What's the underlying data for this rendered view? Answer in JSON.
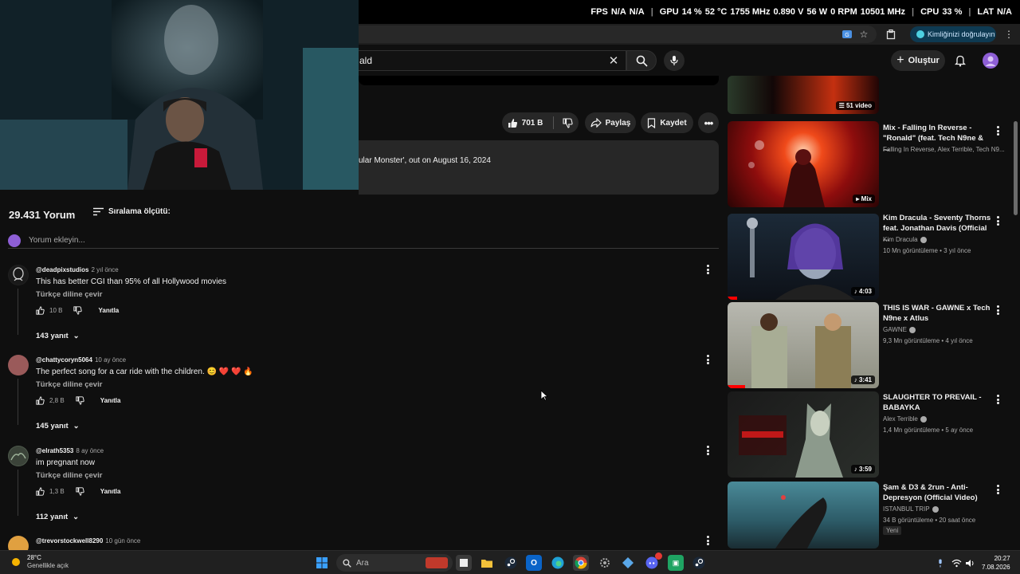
{
  "osd": {
    "fps_label": "FPS",
    "fps_value1": "N/A",
    "fps_value2": "N/A",
    "gpu_label": "GPU",
    "gpu_load": "14 %",
    "gpu_temp": "52 °C",
    "gpu_clock": "1755 MHz",
    "gpu_volt": "0.890 V",
    "gpu_power": "56 W",
    "gpu_fan": "0 RPM",
    "gpu_mem": "10501 MHz",
    "cpu_label": "CPU",
    "cpu_load": "33 %",
    "lat_label": "LAT",
    "lat_value": "N/A"
  },
  "browser": {
    "identity_button": "Kimliğinizi doğrulayın"
  },
  "header": {
    "search_value": "ald",
    "create_label": "Oluştur"
  },
  "actions": {
    "like_count": "701 B",
    "share_label": "Paylaş",
    "save_label": "Kaydet"
  },
  "description": {
    "text": "ular Monster', out on August 16, 2024"
  },
  "comments_section": {
    "count": "29.431 Yorum",
    "sort_label": "Sıralama ölçütü:",
    "add_placeholder": "Yorum ekleyin...",
    "comments": [
      {
        "author": "@deadpixstudios",
        "time": "2 yıl önce",
        "text": "This has better CGI than 95% of all Hollywood movies",
        "translate": "Türkçe diline çevir",
        "likes": "10 B",
        "reply": "Yanıtla",
        "replies": "143 yanıt",
        "avatar_color": "#d8d8d8"
      },
      {
        "author": "@chattycoryn5064",
        "time": "10 ay önce",
        "text": "The perfect song for a car ride with the children. 😊 ❤️ ❤️ 🔥",
        "translate": "Türkçe diline çevir",
        "likes": "2,8 B",
        "reply": "Yanıtla",
        "replies": "145 yanıt",
        "avatar_color": "#9a5a5a"
      },
      {
        "author": "@elrath5353",
        "time": "8 ay önce",
        "text": "im pregnant now",
        "translate": "Türkçe diline çevir",
        "likes": "1,3 B",
        "reply": "Yanıtla",
        "replies": "112 yanıt",
        "avatar_color": "#5c6b5a"
      },
      {
        "author": "@trevorstockwell8290",
        "time": "10 gün önce",
        "avatar_color": "#e0a040"
      }
    ]
  },
  "sidebar": {
    "videos": [
      {
        "badge": "51 video"
      },
      {
        "title": "Mix - Falling In Reverse - \"Ronald\" (feat. Tech N9ne & ...",
        "channel": "Falling In Reverse, Alex Terrible, Tech N9...",
        "badge": "Mix"
      },
      {
        "title": "Kim Dracula - Seventy Thorns feat. Jonathan Davis (Official ...",
        "channel": "Kim Dracula",
        "meta": "10 Mn görüntüleme • 3 yıl önce",
        "badge": "4:03"
      },
      {
        "title": "THIS IS WAR - GAWNE x Tech N9ne x Atlus",
        "channel": "GAWNE",
        "meta": "9,3 Mn görüntüleme • 4 yıl önce",
        "badge": "3:41"
      },
      {
        "title": "SLAUGHTER TO PREVAIL - BABAYKA",
        "channel": "Alex Terrible",
        "meta": "1,4 Mn görüntüleme • 5 ay önce",
        "badge": "3:59"
      },
      {
        "title": "Şam & D3 & 2run - Anti-Depresyon (Official Video)",
        "channel": "ISTANBUL TRIP",
        "meta": "34 B görüntüleme • 20 saat önce",
        "new_tag": "Yeni"
      }
    ]
  },
  "taskbar": {
    "temp": "28°C",
    "weather": "Genellikle açık",
    "search": "Ara",
    "time": "20:27",
    "date": "7.08.2026"
  }
}
